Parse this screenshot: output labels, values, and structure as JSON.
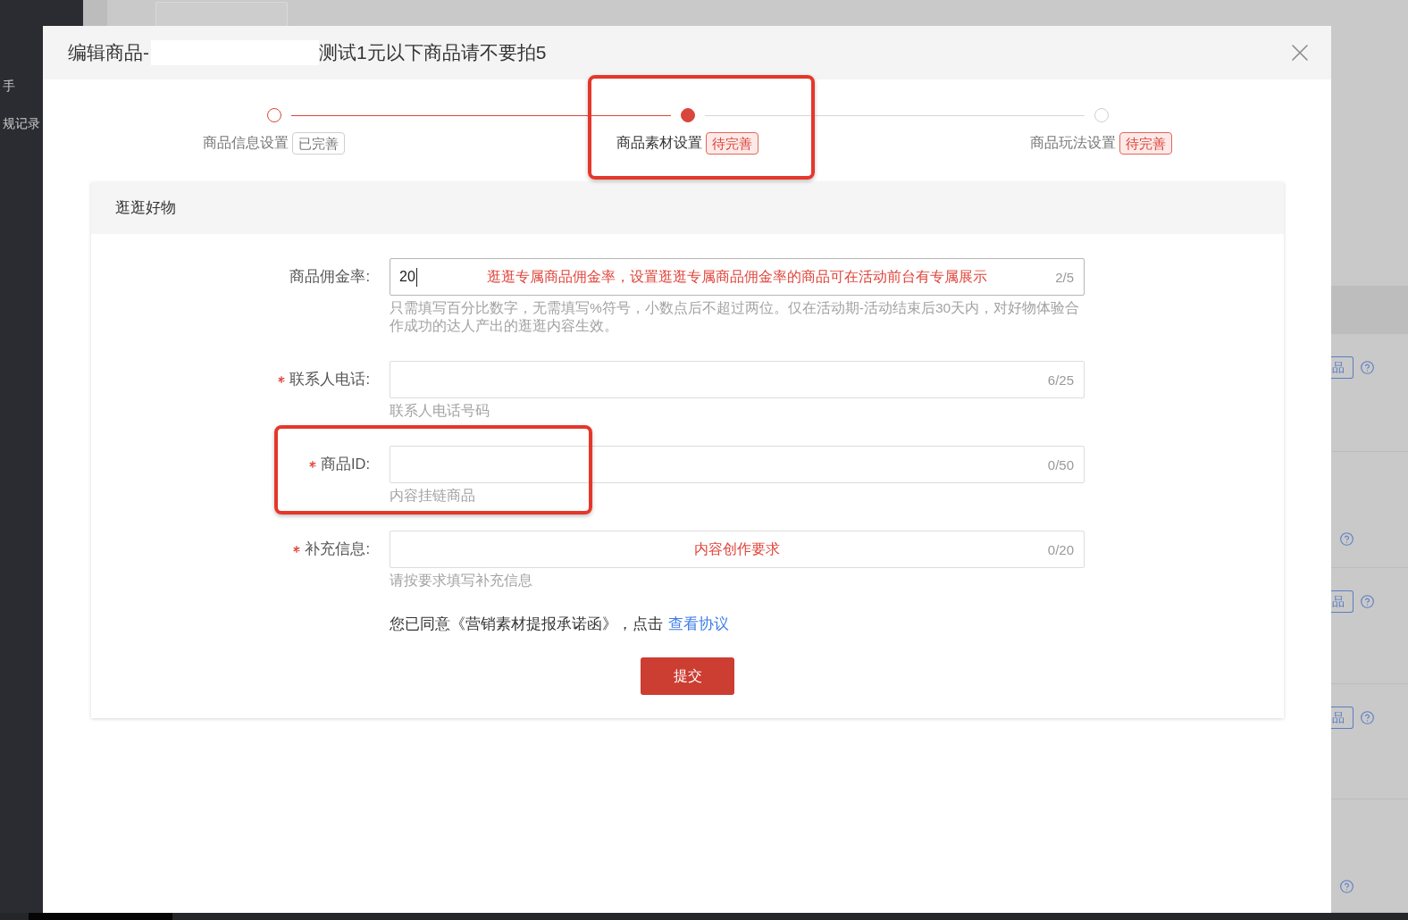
{
  "sidebar": {
    "items": [
      "手",
      "规记录"
    ]
  },
  "background_table": {
    "rows": [
      {
        "kind": "button-help",
        "button": "品"
      },
      {
        "kind": "help"
      },
      {
        "kind": "button-help",
        "button": "品"
      },
      {
        "kind": "button-help",
        "button": "品"
      },
      {
        "kind": "help"
      }
    ]
  },
  "modal": {
    "title_prefix": "编辑商品-",
    "redacted": true,
    "title_suffix": "测试1元以下商品请不要拍5",
    "steps": [
      {
        "label": "商品信息设置",
        "badge": "已完善",
        "complete": true,
        "reached": true,
        "selected": false,
        "highlighted": false
      },
      {
        "label": "商品素材设置",
        "badge": "待完善",
        "complete": false,
        "reached": true,
        "selected": true,
        "highlighted": true
      },
      {
        "label": "商品玩法设置",
        "badge": "待完善",
        "complete": false,
        "reached": false,
        "selected": false,
        "highlighted": false
      }
    ],
    "section": {
      "title": "逛逛好物",
      "fields": [
        {
          "label": "商品佣金率:",
          "required": false,
          "value": "20",
          "focused": true,
          "note": "逛逛专属商品佣金率，设置逛逛专属商品佣金率的商品可在活动前台有专属展示",
          "counter": "2/5",
          "hint": "只需填写百分比数字，无需填写%符号，小数点后不超过两位。仅在活动期-活动结束后30天内，对好物体验合作成功的达人产出的逛逛内容生效。",
          "highlighted": false
        },
        {
          "label": "联系人电话:",
          "required": true,
          "focused": false,
          "counter": "6/25",
          "hint": "联系人电话号码",
          "highlighted": false
        },
        {
          "label": "商品ID:",
          "required": true,
          "focused": false,
          "counter": "0/50",
          "hint": "内容挂链商品",
          "highlighted": true
        },
        {
          "label": "补充信息:",
          "required": true,
          "focused": false,
          "note": "内容创作要求",
          "counter": "0/20",
          "hint": "请按要求填写补充信息",
          "highlighted": false
        }
      ],
      "agreement": {
        "text": "您已同意《营销素材提报承诺函》，点击",
        "link": "查看协议"
      },
      "submit_button": "提交"
    }
  }
}
